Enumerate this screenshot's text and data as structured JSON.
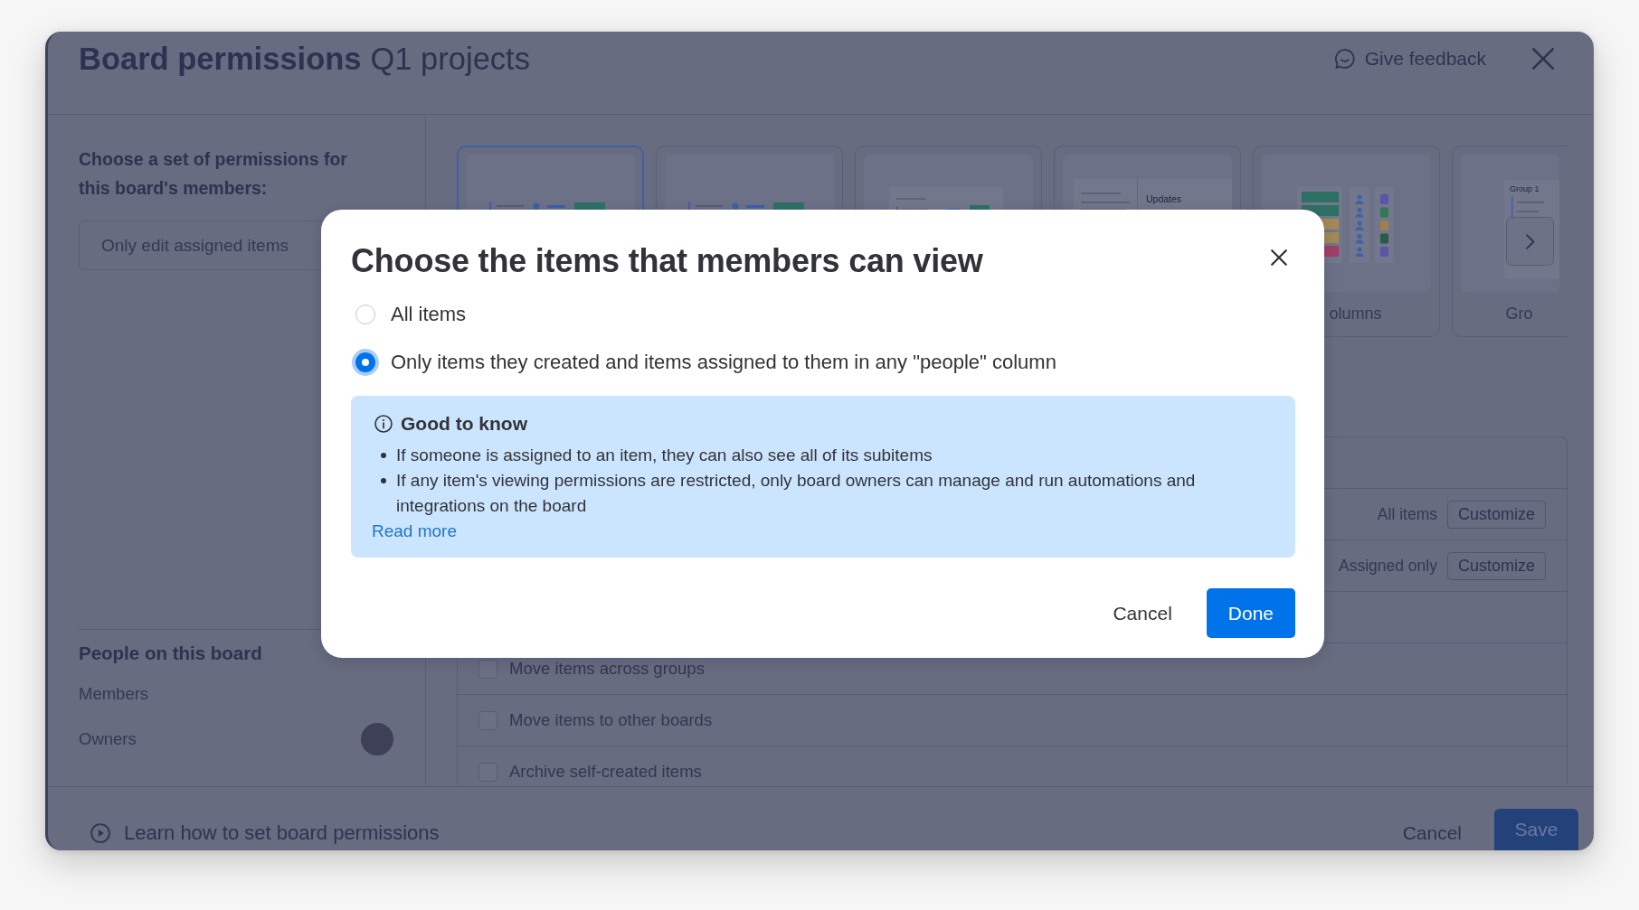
{
  "window": {
    "title": "Board permissions",
    "subtitle": "Q1 projects",
    "feedback_link": "Give feedback"
  },
  "sidebar": {
    "heading": "Choose a set of permissions for this board's members:",
    "permission_select": {
      "value": "Only edit assigned items"
    },
    "people": {
      "heading": "People on this board",
      "rows": [
        {
          "label": "Members",
          "avatar": false
        },
        {
          "label": "Owners",
          "avatar": true
        }
      ]
    }
  },
  "templates": {
    "cards": [
      {
        "kind": "table",
        "selected": true
      },
      {
        "kind": "table",
        "selected": false
      },
      {
        "kind": "panel",
        "selected": false
      },
      {
        "kind": "updates",
        "selected": false,
        "preview_text": "Updates"
      },
      {
        "kind": "columns",
        "selected": false,
        "label": "olumns"
      },
      {
        "kind": "groups",
        "selected": false,
        "preview_text": "Group 1",
        "label": "Gro"
      }
    ]
  },
  "permissions_table": {
    "rows": [
      {
        "kind": "blank"
      },
      {
        "kind": "setting",
        "value": "All items",
        "button": "Customize"
      },
      {
        "kind": "setting",
        "value": "Assigned only",
        "button": "Customize"
      },
      {
        "kind": "blank"
      },
      {
        "kind": "checkbox",
        "label": "Move items across groups",
        "checked": false,
        "disabled": true
      },
      {
        "kind": "checkbox",
        "label": "Move items to other boards",
        "checked": false,
        "disabled": true
      },
      {
        "kind": "checkbox",
        "label": "Archive self-created items",
        "checked": false,
        "disabled": true
      }
    ]
  },
  "footer": {
    "help_link": "Learn how to set board permissions",
    "buttons": [
      {
        "label": "Cancel",
        "kind": "secondary"
      },
      {
        "label": "Save",
        "kind": "primary"
      }
    ]
  },
  "dialog": {
    "title": "Choose the items that members can view",
    "options": [
      {
        "label": "All items",
        "selected": false
      },
      {
        "label": "Only items they created and items assigned to them in any \"people\" column",
        "selected": true
      }
    ],
    "notice": {
      "title": "Good to know",
      "bullets": [
        "If someone is assigned to an item, they can also see all of its subitems",
        "If any item's viewing permissions are restricted, only board owners can manage and run automations and integrations on the board"
      ],
      "link": "Read more"
    },
    "buttons": [
      {
        "label": "Cancel",
        "kind": "secondary"
      },
      {
        "label": "Done",
        "kind": "primary"
      }
    ]
  }
}
